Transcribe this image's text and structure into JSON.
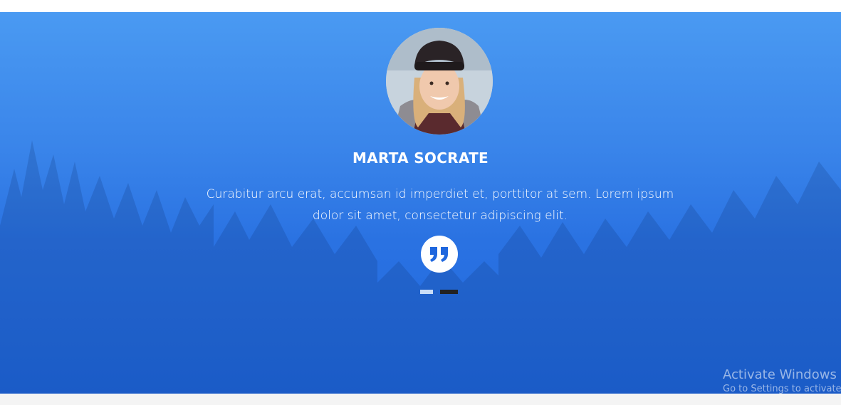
{
  "testimonial": {
    "name": "MARTA SOCRATE",
    "text": "Curabitur arcu erat, accumsan id imperdiet et, porttitor at sem. Lorem ipsum dolor sit amet, consectetur adipiscing elit.",
    "quote_icon": "quote-icon",
    "avatar_icon": "avatar",
    "dots": [
      {
        "label": "",
        "active": false
      },
      {
        "label": "",
        "active": true
      }
    ]
  },
  "watermark": {
    "title": "Activate Windows",
    "subtitle": "Go to Settings to activate"
  },
  "colors": {
    "section_bg": "#2a72e2",
    "text": "#ffffff",
    "dot_active": "#222222",
    "dot_inactive": "#c9ddf7",
    "quote_accent": "#1f67de"
  }
}
